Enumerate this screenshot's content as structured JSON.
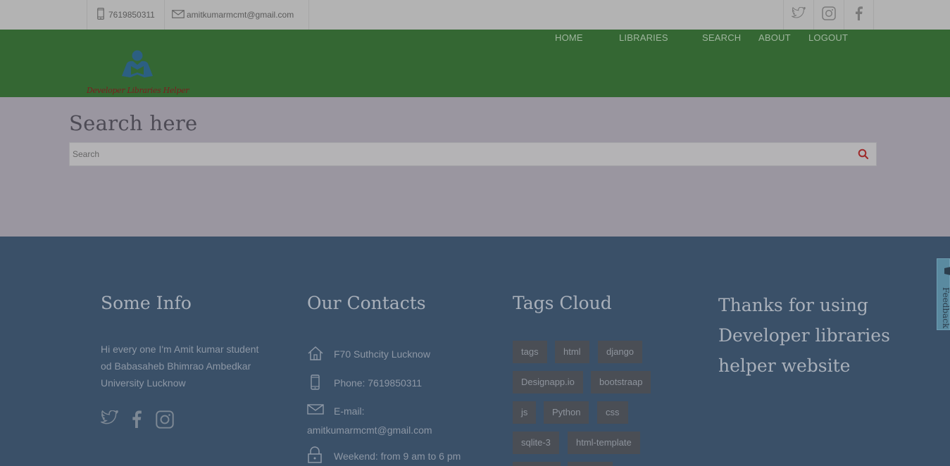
{
  "topbar": {
    "phone": "7619850311",
    "email": "amitkumarmcmt@gmail.com",
    "social": [
      "twitter-icon",
      "instagram-icon",
      "facebook-icon"
    ]
  },
  "header": {
    "logo_text": "Developer Libraries Helper",
    "nav": {
      "home": "HOME",
      "libraries": "LIBRARIES",
      "search": "SEARCH",
      "about": "ABOUT",
      "logout": "LOGOUT"
    }
  },
  "search": {
    "title": "Search here",
    "placeholder": "Search"
  },
  "footer": {
    "info": {
      "title": "Some Info",
      "text": "Hi every one I'm Amit kumar student od Babasaheb Bhimrao Ambedkar University Lucknow"
    },
    "contacts": {
      "title": "Our Contacts",
      "address": "F70 Suthcity Lucknow",
      "phone": "Phone: 7619850311",
      "email_label": "E-mail:",
      "email": "amitkumarmcmt@gmail.com",
      "hours": "Weekend: from 9 am to 6 pm"
    },
    "tags": {
      "title": "Tags Cloud",
      "items": [
        "tags",
        "html",
        "django",
        "Designapp.io",
        "bootstraap",
        "js",
        "Python",
        "css",
        "sqlite-3",
        "html-template"
      ]
    },
    "thanks": "Thanks for using Developer libraries helper website"
  },
  "feedback": {
    "label": "Feedback"
  },
  "colors": {
    "topbar": "#b3b3b3",
    "header": "#346733",
    "search_section": "#9a96a0",
    "footer": "#3a5068",
    "accent_red": "#9e2a2a"
  }
}
